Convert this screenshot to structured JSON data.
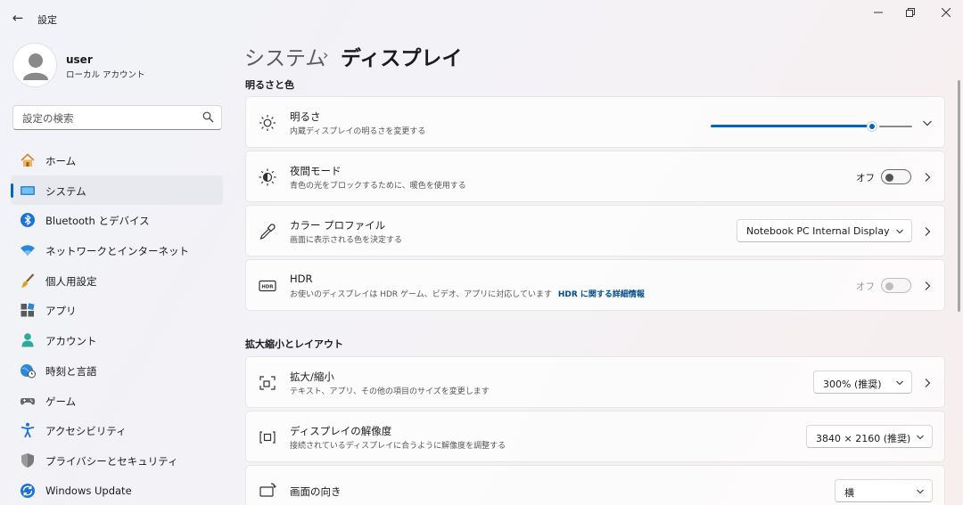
{
  "app": {
    "title": "設定",
    "back": "←"
  },
  "profile": {
    "name": "user",
    "account_type": "ローカル アカウント"
  },
  "search": {
    "placeholder": "設定の検索"
  },
  "nav": {
    "items": [
      {
        "label": "ホーム",
        "icon": "home-icon"
      },
      {
        "label": "システム",
        "icon": "system-icon",
        "active": true
      },
      {
        "label": "Bluetooth とデバイス",
        "icon": "bluetooth-icon"
      },
      {
        "label": "ネットワークとインターネット",
        "icon": "wifi-icon"
      },
      {
        "label": "個人用設定",
        "icon": "brush-icon"
      },
      {
        "label": "アプリ",
        "icon": "apps-icon"
      },
      {
        "label": "アカウント",
        "icon": "account-icon"
      },
      {
        "label": "時刻と言語",
        "icon": "globe-clock-icon"
      },
      {
        "label": "ゲーム",
        "icon": "gamepad-icon"
      },
      {
        "label": "アクセシビリティ",
        "icon": "accessibility-icon"
      },
      {
        "label": "プライバシーとセキュリティ",
        "icon": "shield-icon"
      },
      {
        "label": "Windows Update",
        "icon": "update-icon"
      }
    ]
  },
  "breadcrumb": {
    "parent": "システム",
    "separator": "›",
    "current": "ディスプレイ"
  },
  "sections": {
    "brightness_color": "明るさと色",
    "scale_layout": "拡大縮小とレイアウト"
  },
  "cards": {
    "brightness": {
      "title": "明るさ",
      "subtitle": "内蔵ディスプレイの明るさを変更する",
      "level": 0.8
    },
    "night_light": {
      "title": "夜間モード",
      "subtitle": "青色の光をブロックするために、暖色を使用する",
      "state": "オフ"
    },
    "color_profile": {
      "title": "カラー プロファイル",
      "subtitle": "画面に表示される色を決定する",
      "value": "Notebook PC Internal Display"
    },
    "hdr": {
      "title": "HDR",
      "subtitle": "お使いのディスプレイは HDR ゲーム、ビデオ、アプリに対応しています",
      "link": "HDR に関する詳細情報",
      "state": "オフ"
    },
    "scale": {
      "title": "拡大/縮小",
      "subtitle": "テキスト、アプリ、その他の項目のサイズを変更します",
      "value": "300% (推奨)"
    },
    "resolution": {
      "title": "ディスプレイの解像度",
      "subtitle": "接続されているディスプレイに合うように解像度を調整する",
      "value": "3840 × 2160 (推奨)"
    },
    "orientation": {
      "title": "画面の向き",
      "value": "横"
    }
  },
  "colors": {
    "accent": "#0067c0",
    "link": "#004e8c"
  }
}
